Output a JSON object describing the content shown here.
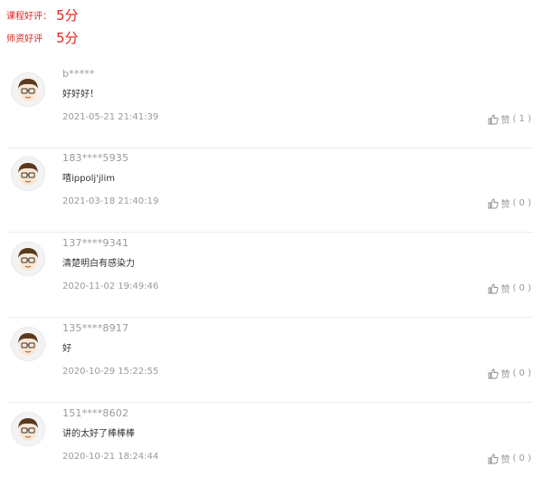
{
  "ratings": [
    {
      "label": "课程好评：",
      "score": "5分"
    },
    {
      "label": "师资好评",
      "score": "5分"
    }
  ],
  "like_label": "赞",
  "reviews": [
    {
      "user": "b*****",
      "comment": "好好好！",
      "date": "2021-05-21 21:41:39",
      "likes": "( 1 )"
    },
    {
      "user": "183****5935",
      "comment": "嘻ippolj'jlim",
      "date": "2021-03-18 21:40:19",
      "likes": "( 0 )"
    },
    {
      "user": "137****9341",
      "comment": "清楚明白有感染力",
      "date": "2020-11-02 19:49:46",
      "likes": "( 0 )"
    },
    {
      "user": "135****8917",
      "comment": "好",
      "date": "2020-10-29 15:22:55",
      "likes": "( 0 )"
    },
    {
      "user": "151****8602",
      "comment": "讲的太好了棒棒棒",
      "date": "2020-10-21 18:24:44",
      "likes": "( 0 )"
    }
  ],
  "icons": {
    "avatar": "cartoon-boy-avatar-icon",
    "like": "thumbs-up-icon"
  },
  "colors": {
    "accent": "#e0251f",
    "muted_text": "#9a9a9a",
    "divider": "#ececec"
  }
}
